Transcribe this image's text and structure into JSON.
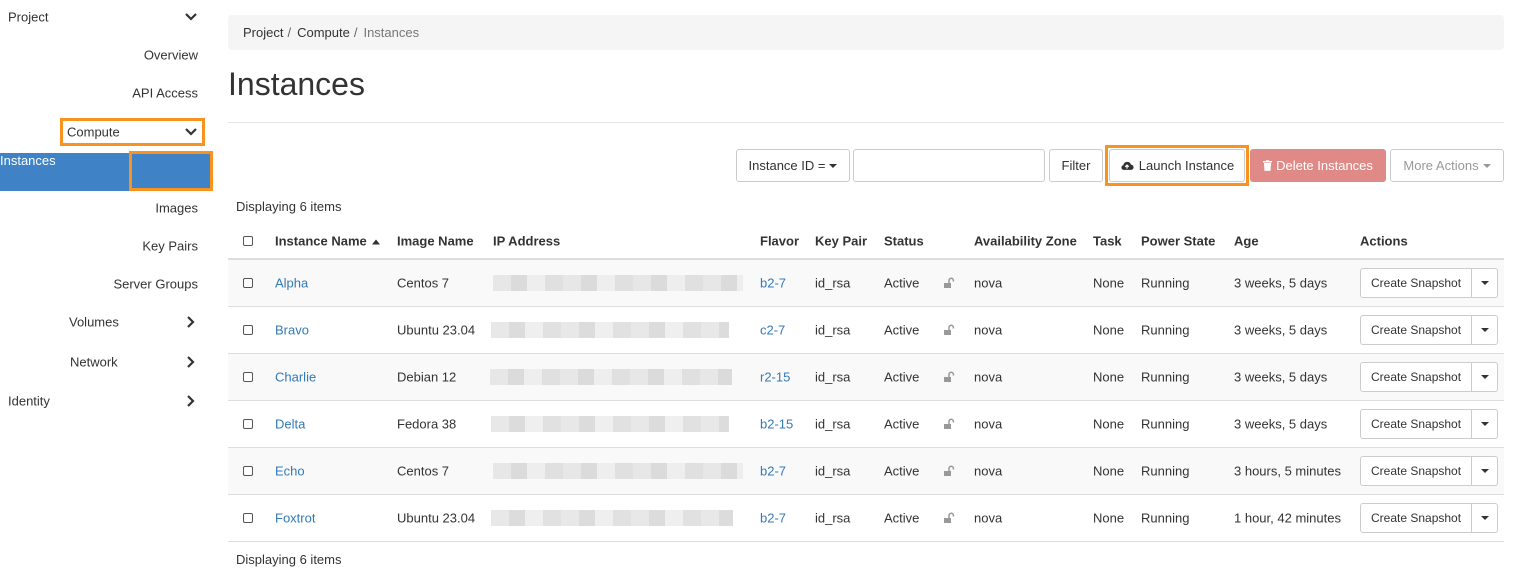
{
  "sidebar": {
    "project": "Project",
    "overview": "Overview",
    "api_access": "API Access",
    "compute": "Compute",
    "instances": "Instances",
    "images": "Images",
    "key_pairs": "Key Pairs",
    "server_groups": "Server Groups",
    "volumes": "Volumes",
    "network": "Network",
    "identity": "Identity"
  },
  "breadcrumb": [
    "Project",
    "Compute",
    "Instances"
  ],
  "page_title": "Instances",
  "toolbar": {
    "filter_field": "Instance ID =",
    "filter_value": "",
    "filter_button": "Filter",
    "launch_button": "Launch Instance",
    "delete_button": "Delete Instances",
    "more_actions": "More Actions"
  },
  "displaying": "Displaying 6 items",
  "table": {
    "headers": {
      "name": "Instance Name",
      "image": "Image Name",
      "ip": "IP Address",
      "flavor": "Flavor",
      "key_pair": "Key Pair",
      "status": "Status",
      "zone": "Availability Zone",
      "task": "Task",
      "power": "Power State",
      "age": "Age",
      "actions": "Actions"
    },
    "rows": [
      {
        "name": "Alpha",
        "image": "Centos 7",
        "flavor": "b2-7",
        "key_pair": "id_rsa",
        "status": "Active",
        "zone": "nova",
        "task": "None",
        "power": "Running",
        "age": "3 weeks, 5 days",
        "action": "Create Snapshot"
      },
      {
        "name": "Bravo",
        "image": "Ubuntu 23.04",
        "flavor": "c2-7",
        "key_pair": "id_rsa",
        "status": "Active",
        "zone": "nova",
        "task": "None",
        "power": "Running",
        "age": "3 weeks, 5 days",
        "action": "Create Snapshot"
      },
      {
        "name": "Charlie",
        "image": "Debian 12",
        "flavor": "r2-15",
        "key_pair": "id_rsa",
        "status": "Active",
        "zone": "nova",
        "task": "None",
        "power": "Running",
        "age": "3 weeks, 5 days",
        "action": "Create Snapshot"
      },
      {
        "name": "Delta",
        "image": "Fedora 38",
        "flavor": "b2-15",
        "key_pair": "id_rsa",
        "status": "Active",
        "zone": "nova",
        "task": "None",
        "power": "Running",
        "age": "3 weeks, 5 days",
        "action": "Create Snapshot"
      },
      {
        "name": "Echo",
        "image": "Centos 7",
        "flavor": "b2-7",
        "key_pair": "id_rsa",
        "status": "Active",
        "zone": "nova",
        "task": "None",
        "power": "Running",
        "age": "3 hours, 5 minutes",
        "action": "Create Snapshot"
      },
      {
        "name": "Foxtrot",
        "image": "Ubuntu 23.04",
        "flavor": "b2-7",
        "key_pair": "id_rsa",
        "status": "Active",
        "zone": "nova",
        "task": "None",
        "power": "Running",
        "age": "1 hour, 42 minutes",
        "action": "Create Snapshot"
      }
    ]
  },
  "icons": {
    "chevron_down": "chevron-down-icon",
    "chevron_right": "chevron-right-icon",
    "cloud_upload": "cloud-upload-icon",
    "trash": "trash-icon",
    "lock": "unlock-icon",
    "sort_asc": "sort-asc-icon"
  },
  "colors": {
    "active_nav": "#3f83c6",
    "highlight": "#f7931e",
    "link": "#337ab7",
    "danger": "#e08a87"
  }
}
